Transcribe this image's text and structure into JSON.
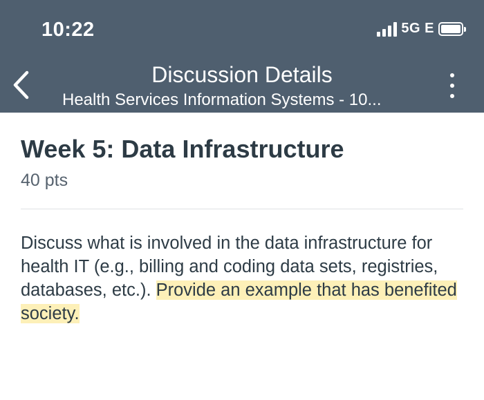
{
  "status_bar": {
    "time": "10:22",
    "network": "5G E"
  },
  "nav": {
    "title": "Discussion Details",
    "subtitle": "Health Services Information Systems - 10..."
  },
  "assignment": {
    "title": "Week 5: Data Infrastructure",
    "points": "40 pts",
    "body_plain": "Discuss what is involved in the data infrastructure for health IT (e.g., billing and coding data sets, registries, databases, etc.).  ",
    "body_highlighted": "Provide an example that has benefited society."
  },
  "colors": {
    "header_bg": "#4f5f6f",
    "text_dark": "#2d3b45",
    "highlight": "#fdf0b8"
  }
}
